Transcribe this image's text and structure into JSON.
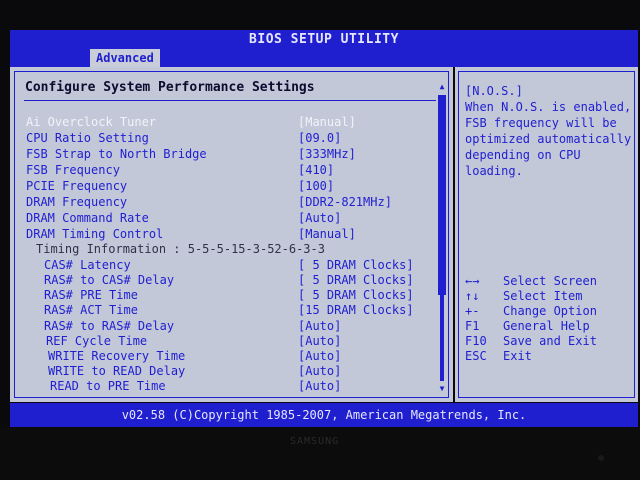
{
  "title": "BIOS SETUP UTILITY",
  "active_tab": "Advanced",
  "section_title": "Configure System Performance Settings",
  "settings": [
    {
      "label": "Ai Overclock Tuner",
      "value": "[Manual]",
      "selected": true
    },
    {
      "label": "CPU Ratio Setting",
      "value": "[09.0]"
    },
    {
      "label": "FSB Strap to North Bridge",
      "value": "[333MHz]"
    },
    {
      "label": "FSB Frequency",
      "value": "[410]"
    },
    {
      "label": "PCIE Frequency",
      "value": "[100]"
    },
    {
      "label": "DRAM Frequency",
      "value": "[DDR2-821MHz]"
    },
    {
      "label": "DRAM Command Rate",
      "value": "[Auto]"
    },
    {
      "label": "DRAM Timing Control",
      "value": "[Manual]"
    }
  ],
  "timing_information": "Timing Information : 5-5-5-15-3-52-6-3-3",
  "timings": [
    {
      "label": "CAS# Latency",
      "value": "[ 5 DRAM Clocks]"
    },
    {
      "label": "RAS# to CAS# Delay",
      "value": "[ 5 DRAM Clocks]"
    },
    {
      "label": "RAS# PRE Time",
      "value": "[ 5 DRAM Clocks]"
    },
    {
      "label": "RAS# ACT Time",
      "value": "[15 DRAM Clocks]"
    },
    {
      "label": "RAS# to RAS# Delay",
      "value": "[Auto]"
    },
    {
      "label": "REF Cycle Time",
      "value": "[Auto]"
    },
    {
      "label": "WRITE Recovery Time",
      "value": "[Auto]"
    },
    {
      "label": "WRITE to READ Delay",
      "value": "[Auto]"
    },
    {
      "label": "READ to PRE Time",
      "value": "[Auto]"
    }
  ],
  "help": {
    "text": "[N.O.S.]\nWhen N.O.S. is enabled,\nFSB frequency will be\noptimized automatically\ndepending on CPU\nloading."
  },
  "keys": [
    {
      "key": "←→",
      "desc": "Select Screen"
    },
    {
      "key": "↑↓",
      "desc": "Select Item"
    },
    {
      "key": "+-",
      "desc": "Change Option"
    },
    {
      "key": "F1",
      "desc": "General Help"
    },
    {
      "key": "F10",
      "desc": "Save and Exit"
    },
    {
      "key": "ESC",
      "desc": "Exit"
    }
  ],
  "footer": "v02.58 (C)Copyright 1985-2007, American Megatrends, Inc.",
  "monitor_brand": "SAMSUNG",
  "colors": {
    "bios_blue": "#1f1fd0",
    "panel_grey": "#c3c8d9",
    "selected_text": "#f2f2f8"
  }
}
